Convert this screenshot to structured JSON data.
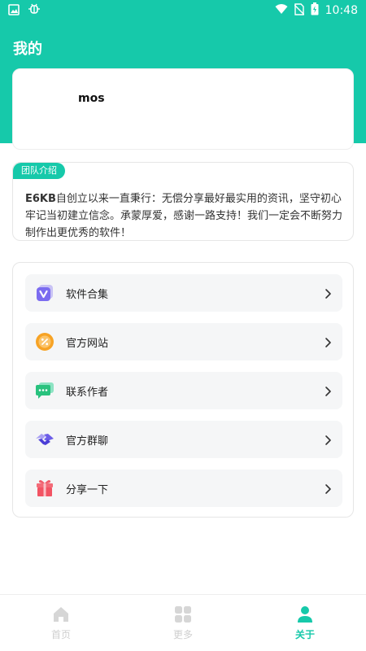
{
  "status_bar": {
    "time": "10:48"
  },
  "page": {
    "title": "我的"
  },
  "profile": {
    "name": "mos"
  },
  "team": {
    "badge": "团队介绍",
    "brand": "E6KB",
    "description": "自创立以来一直秉行：无偿分享最好最实用的资讯，坚守初心牢记当初建立信念。承蒙厚爱，感谢一路支持！我们一定会不断努力制作出更优秀的软件！"
  },
  "menu": {
    "items": [
      {
        "label": "软件合集",
        "icon": "software-collection-icon"
      },
      {
        "label": "官方网站",
        "icon": "official-website-icon"
      },
      {
        "label": "联系作者",
        "icon": "contact-author-icon"
      },
      {
        "label": "官方群聊",
        "icon": "official-group-icon"
      },
      {
        "label": "分享一下",
        "icon": "share-gift-icon"
      }
    ]
  },
  "tabs": [
    {
      "label": "首页",
      "icon": "home-icon",
      "active": false
    },
    {
      "label": "更多",
      "icon": "grid-icon",
      "active": false
    },
    {
      "label": "关于",
      "icon": "person-icon",
      "active": true
    }
  ],
  "colors": {
    "accent": "#16c9aa",
    "inactive": "#cfcfcf"
  }
}
